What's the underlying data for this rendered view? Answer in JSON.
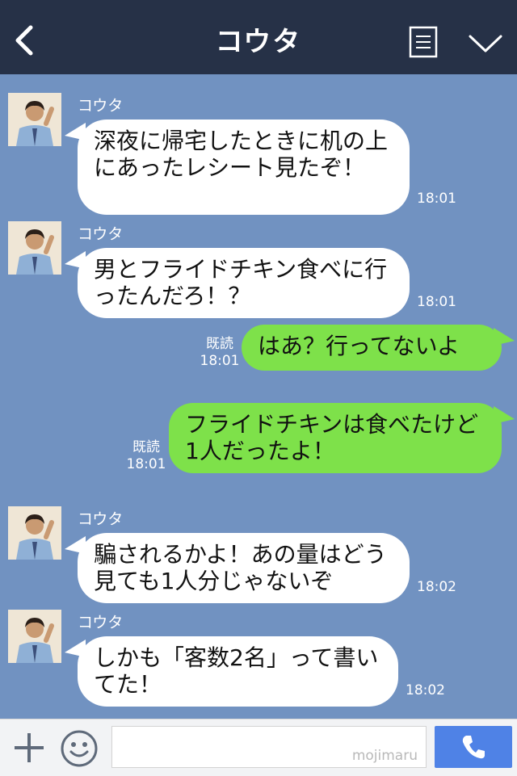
{
  "header": {
    "title": "コウタ"
  },
  "messages": [
    {
      "sender": "コウタ",
      "text": "深夜に帰宅したときに机の上にあったレシート見たぞ！",
      "time": "18:01"
    },
    {
      "sender": "コウタ",
      "text": "男とフライドチキン食べに行ったんだろ！？",
      "time": "18:01"
    },
    {
      "text": "はあ？行ってないよ",
      "read": "既読",
      "time": "18:01"
    },
    {
      "text": "フライドチキンは食べたけど1人だったよ！",
      "read": "既読",
      "time": "18:01"
    },
    {
      "sender": "コウタ",
      "text": "騙されるかよ！あの量はどう見ても1人分じゃないぞ",
      "time": "18:02"
    },
    {
      "sender": "コウタ",
      "text": "しかも「客数2名」って書いてた！",
      "time": "18:02"
    }
  ],
  "input": {
    "watermark": "mojimaru"
  },
  "colors": {
    "background": "#7192c1",
    "header": "#263147",
    "outgoing_bubble": "#7ee14a",
    "call_button": "#4f82e6"
  },
  "icons": [
    "back-chevron-icon",
    "menu-list-icon",
    "chevron-down-icon",
    "plus-icon",
    "emoji-icon",
    "phone-icon"
  ]
}
